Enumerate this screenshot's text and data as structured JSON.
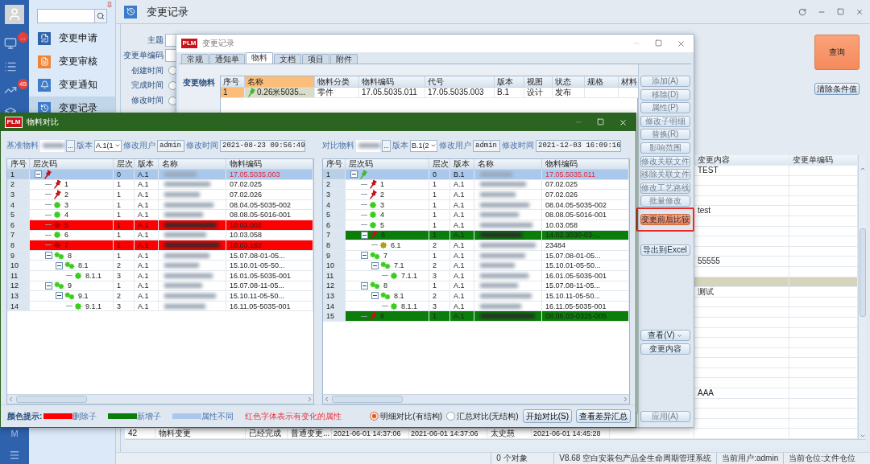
{
  "rail": {
    "items": [
      {
        "kind": "monitor",
        "badge": "..."
      },
      {
        "kind": "list"
      },
      {
        "kind": "chart",
        "badge": "45"
      },
      {
        "kind": "box"
      }
    ],
    "bottom_label": "M"
  },
  "nav": {
    "items": [
      {
        "label": "变更申请",
        "kind": "edit",
        "selected": false
      },
      {
        "label": "变更审核",
        "kind": "review",
        "selected": false
      },
      {
        "label": "变更通知",
        "kind": "bell",
        "selected": false
      },
      {
        "label": "变更记录",
        "kind": "history",
        "selected": true
      }
    ]
  },
  "header": {
    "title": "变更记录"
  },
  "form": {
    "fields": [
      {
        "label": "主题",
        "kind": "text"
      },
      {
        "label": "变更单编码",
        "kind": "text"
      },
      {
        "label": "创建时间",
        "kind": "radio",
        "selected": false
      },
      {
        "label": "完成时间",
        "kind": "radio",
        "selected": false
      },
      {
        "label": "修改时间",
        "kind": "radio",
        "selected": false
      }
    ]
  },
  "query_buttons": [
    {
      "label": "查询",
      "kind": "primary"
    },
    {
      "label": "清除条件值",
      "kind": "secondary"
    }
  ],
  "records_table": {
    "columns": [
      "变更内容",
      "变更单编码"
    ],
    "rows": [
      {
        "change_content": "TEST",
        "selected": false
      },
      {
        "selected": false
      },
      {
        "selected": false
      },
      {
        "selected": false
      },
      {
        "change_content": "test",
        "selected": false
      },
      {
        "selected": false
      },
      {
        "selected": false
      },
      {
        "selected": false
      },
      {
        "selected": false
      },
      {
        "change_content": "55555",
        "selected": false
      },
      {
        "selected": false
      },
      {
        "selected": true
      },
      {
        "change_content": "测试",
        "selected": false
      },
      {
        "selected": false
      },
      {
        "selected": false
      },
      {
        "selected": false
      },
      {
        "selected": false
      },
      {
        "selected": false
      },
      {
        "selected": false
      },
      {
        "selected": false
      },
      {
        "selected": false
      },
      {
        "selected": false
      },
      {
        "change_content": "AAA",
        "selected": false
      },
      {
        "selected": false
      },
      {
        "selected": false
      },
      {
        "selected": false
      },
      {
        "seq": "42",
        "title": "物料变更",
        "status": "已经完成",
        "type": "普通变更...",
        "created": "2021-06-01 14:37:06",
        "completed": "2021-06-01 14:37:06",
        "person": "太史慈",
        "modified": "2021-06-01 14:45:28",
        "selected": false
      }
    ]
  },
  "status_bar": [
    "0 个对象",
    "V8.68 空白安装包产品全生命周期管理系统",
    "当前用户:admin",
    "当前仓位:文件仓位"
  ],
  "record_dialog": {
    "logo": "PLM",
    "title": "变更记录",
    "tabs": [
      {
        "label": "常规",
        "selected": false
      },
      {
        "label": "通知单",
        "selected": false
      },
      {
        "label": "物料",
        "selected": true
      },
      {
        "label": "文档",
        "selected": false
      },
      {
        "label": "项目",
        "selected": false
      },
      {
        "label": "附件",
        "selected": false
      }
    ],
    "section_label": "变更物料",
    "table": {
      "columns": [
        {
          "label": "序号",
          "selected": false
        },
        {
          "label": "名称",
          "selected": true
        },
        {
          "label": "物料分类",
          "selected": false
        },
        {
          "label": "物料编码",
          "selected": false
        },
        {
          "label": "代号",
          "selected": false
        },
        {
          "label": "版本",
          "selected": false
        },
        {
          "label": "视图",
          "selected": false
        },
        {
          "label": "状态",
          "selected": false
        },
        {
          "label": "规格",
          "selected": false
        },
        {
          "label": "材料",
          "selected": false
        }
      ],
      "rows": [
        {
          "seq": "1",
          "name": "0.26米5035...",
          "category": "零件",
          "code": "17.05.5035.011",
          "number": "17.05.5035.003",
          "version": "B.1",
          "view": "设计",
          "status": "发布",
          "selected": true
        }
      ]
    },
    "button_groups": [
      [
        {
          "label": "添加(A)",
          "kind": "plain",
          "disabled": true
        },
        {
          "label": "移除(D)",
          "kind": "plain",
          "disabled": true
        },
        {
          "label": "属性(P)",
          "kind": "plain",
          "disabled": true
        },
        {
          "label": "修改子明细",
          "kind": "plain",
          "disabled": true
        },
        {
          "label": "替换(R)",
          "kind": "plain",
          "disabled": true
        },
        {
          "label": "影响范围",
          "kind": "plain",
          "disabled": true
        },
        {
          "label": "修改关联文件",
          "kind": "plain",
          "disabled": true
        },
        {
          "label": "移除关联文件",
          "kind": "plain",
          "disabled": true
        },
        {
          "label": "修改工艺路线",
          "kind": "plain",
          "disabled": true
        },
        {
          "label": "批量修改",
          "kind": "plain",
          "disabled": true
        }
      ],
      [
        {
          "label": "变更前后比较",
          "kind": "highlight",
          "disabled": false
        }
      ],
      [
        {
          "label": "导出到Excel",
          "kind": "plain",
          "disabled": false
        }
      ],
      [
        {
          "label": "查看(V)",
          "kind": "dropdown",
          "disabled": false
        },
        {
          "label": "变更内容",
          "kind": "plain",
          "disabled": false
        }
      ],
      [
        {
          "label": "应用(A)",
          "kind": "plain",
          "disabled": true
        }
      ]
    ]
  },
  "compare_dialog": {
    "logo": "PLM",
    "title": "物料对比",
    "panes": [
      {
        "label": "基准物料",
        "browse": "...",
        "version_label": "版本",
        "version": "A.1(1",
        "user_label": "修改用户",
        "user": "admin",
        "time_label": "修改时间",
        "time": "2021-08-23 09:56:49",
        "columns": [
          "序号",
          "层次码",
          "层次",
          "版本",
          "名称",
          "物料编码"
        ],
        "tree": [
          {
            "seq": "1",
            "level": "0",
            "version": "A.1",
            "material_code": "17.05.5035.003",
            "kind": "pin-red",
            "deleted": false,
            "added": false,
            "selected": true,
            "code_changed": true,
            "expanded": true,
            "children": [
              {
                "seq": "2",
                "code": "1",
                "level": "1",
                "version": "A.1",
                "material_code": "07.02.025",
                "kind": "pin-red",
                "deleted": false,
                "added": false,
                "selected": false,
                "code_changed": false
              },
              {
                "seq": "3",
                "code": "2",
                "level": "1",
                "version": "A.1",
                "material_code": "07.02.026",
                "kind": "pin-red",
                "deleted": false,
                "added": false,
                "selected": false,
                "code_changed": false
              },
              {
                "seq": "4",
                "code": "3",
                "level": "1",
                "version": "A.1",
                "material_code": "08.04.05-5035-002",
                "kind": "gear",
                "deleted": false,
                "added": false,
                "selected": false,
                "code_changed": false
              },
              {
                "seq": "5",
                "code": "4",
                "level": "1",
                "version": "A.1",
                "material_code": "08.08.05-5016-001",
                "kind": "gear",
                "deleted": false,
                "added": false,
                "selected": false,
                "code_changed": false
              },
              {
                "seq": "6",
                "code": "5",
                "level": "1",
                "version": "A.1",
                "material_code": "10.03.002",
                "kind": "gear",
                "deleted": true,
                "added": false,
                "selected": false,
                "code_changed": false
              },
              {
                "seq": "7",
                "code": "6",
                "level": "1",
                "version": "A.1",
                "material_code": "10.03.058",
                "kind": "gear",
                "deleted": false,
                "added": false,
                "selected": false,
                "code_changed": false
              },
              {
                "seq": "8",
                "code": "7",
                "level": "1",
                "version": "A.1",
                "material_code": "10.03.162",
                "kind": "gear",
                "deleted": true,
                "added": false,
                "selected": false,
                "code_changed": false
              },
              {
                "seq": "9",
                "code": "8",
                "level": "1",
                "version": "A.1",
                "material_code": "15.07.08-01-05...",
                "kind": "gears",
                "deleted": false,
                "added": false,
                "selected": false,
                "code_changed": false,
                "expanded": true,
                "children": [
                  {
                    "seq": "10",
                    "code": "8.1",
                    "level": "2",
                    "version": "A.1",
                    "material_code": "15.10.01-05-50...",
                    "kind": "gears",
                    "deleted": false,
                    "added": false,
                    "selected": false,
                    "code_changed": false,
                    "expanded": true,
                    "children": [
                      {
                        "seq": "11",
                        "code": "8.1.1",
                        "level": "3",
                        "version": "A.1",
                        "material_code": "16.01.05-5035-001",
                        "kind": "gear",
                        "deleted": false,
                        "added": false,
                        "selected": false,
                        "code_changed": false
                      }
                    ]
                  }
                ]
              },
              {
                "seq": "12",
                "code": "9",
                "level": "1",
                "version": "A.1",
                "material_code": "15.07.08-11-05...",
                "kind": "gears",
                "deleted": false,
                "added": false,
                "selected": false,
                "code_changed": false,
                "expanded": true,
                "children": [
                  {
                    "seq": "13",
                    "code": "9.1",
                    "level": "2",
                    "version": "A.1",
                    "material_code": "15.10.11-05-50...",
                    "kind": "gears",
                    "deleted": false,
                    "added": false,
                    "selected": false,
                    "code_changed": false,
                    "expanded": true,
                    "children": [
                      {
                        "seq": "14",
                        "code": "9.1.1",
                        "level": "3",
                        "version": "A.1",
                        "material_code": "16.11.05-5035-001",
                        "kind": "gear",
                        "deleted": false,
                        "added": false,
                        "selected": false,
                        "code_changed": false
                      }
                    ]
                  }
                ]
              }
            ]
          }
        ]
      },
      {
        "label": "对比物料",
        "browse": "...",
        "version_label": "版本",
        "version": "B.1(2",
        "user_label": "修改用户",
        "user": "admin",
        "time_label": "修改时间",
        "time": "2021-12-03 16:09:16",
        "columns": [
          "序号",
          "层次码",
          "层次",
          "版本",
          "名称",
          "物料编码"
        ],
        "tree": [
          {
            "seq": "1",
            "level": "0",
            "version": "B.1",
            "material_code": "17.05.5035.011",
            "kind": "pin-green",
            "deleted": false,
            "added": false,
            "selected": true,
            "code_changed": true,
            "expanded": true,
            "children": [
              {
                "seq": "2",
                "code": "1",
                "level": "1",
                "version": "A.1",
                "material_code": "07.02.025",
                "kind": "pin-red",
                "deleted": false,
                "added": false,
                "selected": false,
                "code_changed": false
              },
              {
                "seq": "3",
                "code": "2",
                "level": "1",
                "version": "A.1",
                "material_code": "07.02.026",
                "kind": "pin-red",
                "deleted": false,
                "added": false,
                "selected": false,
                "code_changed": false
              },
              {
                "seq": "4",
                "code": "3",
                "level": "1",
                "version": "A.1",
                "material_code": "08.04.05-5035-002",
                "kind": "gear",
                "deleted": false,
                "added": false,
                "selected": false,
                "code_changed": false
              },
              {
                "seq": "5",
                "code": "4",
                "level": "1",
                "version": "A.1",
                "material_code": "08.08.05-5016-001",
                "kind": "gear",
                "deleted": false,
                "added": false,
                "selected": false,
                "code_changed": false
              },
              {
                "seq": "6",
                "code": "5",
                "level": "1",
                "version": "A.1",
                "material_code": "10.03.058",
                "kind": "gear",
                "deleted": false,
                "added": false,
                "selected": false,
                "code_changed": false
              },
              {
                "seq": "7",
                "code": "6",
                "level": "1",
                "version": "A.1",
                "material_code": "14.02.3030-03-...",
                "kind": "pin-red",
                "deleted": false,
                "added": true,
                "selected": false,
                "code_changed": false,
                "expanded": true,
                "children": [
                  {
                    "seq": "8",
                    "code": "6.1",
                    "level": "2",
                    "version": "A.1",
                    "material_code": "23484",
                    "kind": "gear-olive",
                    "deleted": false,
                    "added": false,
                    "selected": false,
                    "code_changed": false
                  }
                ]
              },
              {
                "seq": "9",
                "code": "7",
                "level": "1",
                "version": "A.1",
                "material_code": "15.07.08-01-05...",
                "kind": "gears",
                "deleted": false,
                "added": false,
                "selected": false,
                "code_changed": false,
                "expanded": true,
                "children": [
                  {
                    "seq": "10",
                    "code": "7.1",
                    "level": "2",
                    "version": "A.1",
                    "material_code": "15.10.01-05-50...",
                    "kind": "gears",
                    "deleted": false,
                    "added": false,
                    "selected": false,
                    "code_changed": false,
                    "expanded": true,
                    "children": [
                      {
                        "seq": "11",
                        "code": "7.1.1",
                        "level": "3",
                        "version": "A.1",
                        "material_code": "16.01.05-5035-001",
                        "kind": "gear",
                        "deleted": false,
                        "added": false,
                        "selected": false,
                        "code_changed": false
                      }
                    ]
                  }
                ]
              },
              {
                "seq": "12",
                "code": "8",
                "level": "1",
                "version": "A.1",
                "material_code": "15.07.08-11-05...",
                "kind": "gears",
                "deleted": false,
                "added": false,
                "selected": false,
                "code_changed": false,
                "expanded": true,
                "children": [
                  {
                    "seq": "13",
                    "code": "8.1",
                    "level": "2",
                    "version": "A.1",
                    "material_code": "15.10.11-05-50...",
                    "kind": "gears",
                    "deleted": false,
                    "added": false,
                    "selected": false,
                    "code_changed": false,
                    "expanded": true,
                    "children": [
                      {
                        "seq": "14",
                        "code": "8.1.1",
                        "level": "3",
                        "version": "A.1",
                        "material_code": "16.11.05-5035-001",
                        "kind": "gear",
                        "deleted": false,
                        "added": false,
                        "selected": false,
                        "code_changed": false
                      }
                    ]
                  }
                ]
              },
              {
                "seq": "15",
                "code": "9",
                "level": "1",
                "version": "A.1",
                "material_code": "08.06.03-0325-005",
                "kind": "pin-red",
                "deleted": false,
                "added": true,
                "selected": false,
                "code_changed": false
              }
            ]
          }
        ]
      }
    ],
    "legend": {
      "title": "颜色提示:",
      "items": [
        {
          "label": "删除子",
          "color": "#ff0000"
        },
        {
          "label": "新增子",
          "color": "#0a7d0a"
        },
        {
          "label": "属性不同",
          "color": "#a9c8ec"
        }
      ],
      "note": "红色字体表示有变化的属性"
    },
    "modes": [
      {
        "label": "明细对比(有结构)",
        "selected": true
      },
      {
        "label": "汇总对比(无结构)",
        "selected": false
      }
    ],
    "buttons": [
      "开始对比(S)",
      "查看差异汇总"
    ]
  }
}
